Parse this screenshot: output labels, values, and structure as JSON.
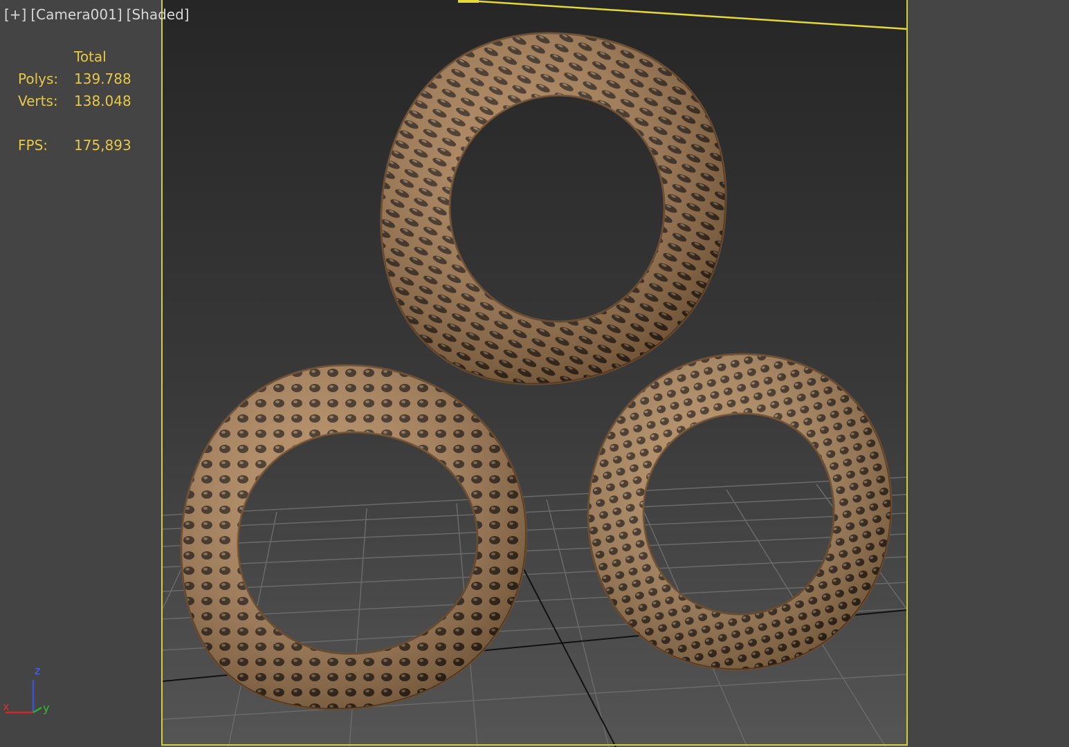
{
  "viewport": {
    "labels": {
      "menu": "[+]",
      "camera": "[Camera001]",
      "shading": "[Shaded]"
    },
    "stats": {
      "header": "Total",
      "polys_label": "Polys:",
      "polys_value": "139.788",
      "verts_label": "Verts:",
      "verts_value": "138.048",
      "fps_label": "FPS:",
      "fps_value": "175,893"
    },
    "axis": {
      "x": "x",
      "y": "y",
      "z": "z"
    },
    "colors": {
      "background": "#444444",
      "safe_frame": "#d6cf3a",
      "stats_text": "#e6c84a",
      "label_text": "#d8d8d8",
      "ring_material": "#a97b52",
      "grid": "#6b6b6b"
    },
    "objects": [
      {
        "name": "voronoi-ring-top"
      },
      {
        "name": "voronoi-ring-bottom-left"
      },
      {
        "name": "voronoi-ring-bottom-right"
      }
    ]
  }
}
